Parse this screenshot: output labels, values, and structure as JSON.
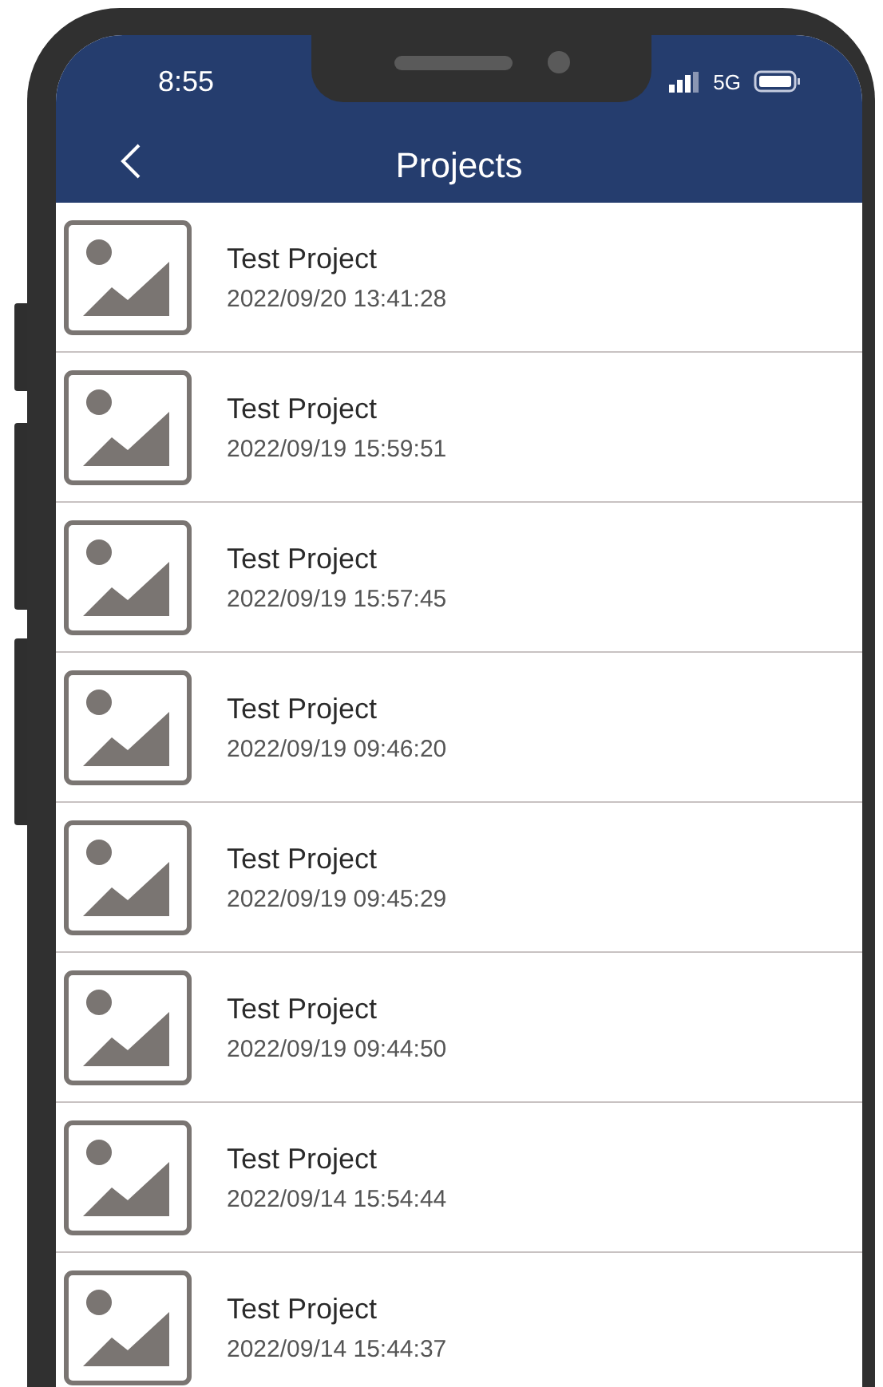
{
  "status_bar": {
    "time": "8:55",
    "network": "5G"
  },
  "nav_bar": {
    "title": "Projects"
  },
  "projects": [
    {
      "title": "Test Project",
      "date": "2022/09/20 13:41:28"
    },
    {
      "title": "Test Project",
      "date": "2022/09/19 15:59:51"
    },
    {
      "title": "Test Project",
      "date": "2022/09/19 15:57:45"
    },
    {
      "title": "Test Project",
      "date": "2022/09/19 09:46:20"
    },
    {
      "title": "Test Project",
      "date": "2022/09/19 09:45:29"
    },
    {
      "title": "Test Project",
      "date": "2022/09/19 09:44:50"
    },
    {
      "title": "Test Project",
      "date": "2022/09/14 15:54:44"
    },
    {
      "title": "Test Project",
      "date": "2022/09/14 15:44:37"
    }
  ]
}
